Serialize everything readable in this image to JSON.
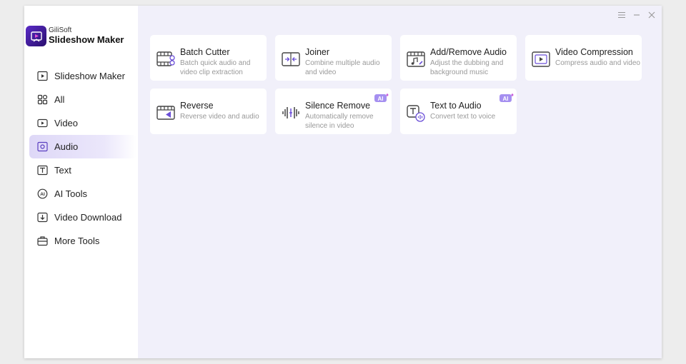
{
  "app": {
    "brand": "GiliSoft",
    "product": "Slideshow Maker"
  },
  "sidebar": {
    "items": [
      {
        "label": "Slideshow Maker",
        "icon": "slideshow-icon",
        "active": false
      },
      {
        "label": "All",
        "icon": "grid-icon",
        "active": false
      },
      {
        "label": "Video",
        "icon": "video-icon",
        "active": false
      },
      {
        "label": "Audio",
        "icon": "audio-icon",
        "active": true
      },
      {
        "label": "Text",
        "icon": "text-icon",
        "active": false
      },
      {
        "label": "AI Tools",
        "icon": "ai-icon",
        "active": false
      },
      {
        "label": "Video Download",
        "icon": "download-icon",
        "active": false
      },
      {
        "label": "More Tools",
        "icon": "toolbox-icon",
        "active": false
      }
    ]
  },
  "cards": [
    {
      "title": "Batch Cutter",
      "desc": "Batch quick audio and video clip extraction",
      "icon": "film-cut-icon",
      "ai": false
    },
    {
      "title": "Joiner",
      "desc": "Combine multiple audio and video",
      "icon": "join-icon",
      "ai": false
    },
    {
      "title": "Add/Remove Audio",
      "desc": "Adjust the dubbing and background music",
      "icon": "music-note-icon",
      "ai": false
    },
    {
      "title": "Video Compression",
      "desc": "Compress audio and video",
      "icon": "compress-icon",
      "ai": false
    },
    {
      "title": "Reverse",
      "desc": "Reverse video and audio",
      "icon": "reverse-icon",
      "ai": false
    },
    {
      "title": "Silence Remove",
      "desc": "Automatically remove silence in video",
      "icon": "waveform-icon",
      "ai": true
    },
    {
      "title": "Text to Audio",
      "desc": "Convert text to voice",
      "icon": "text-speech-icon",
      "ai": true
    }
  ],
  "badge": {
    "ai_label": "AI"
  },
  "colors": {
    "accent": "#6b4fd8",
    "active_bg": "#ded8f7",
    "main_bg": "#f1f0fa"
  }
}
